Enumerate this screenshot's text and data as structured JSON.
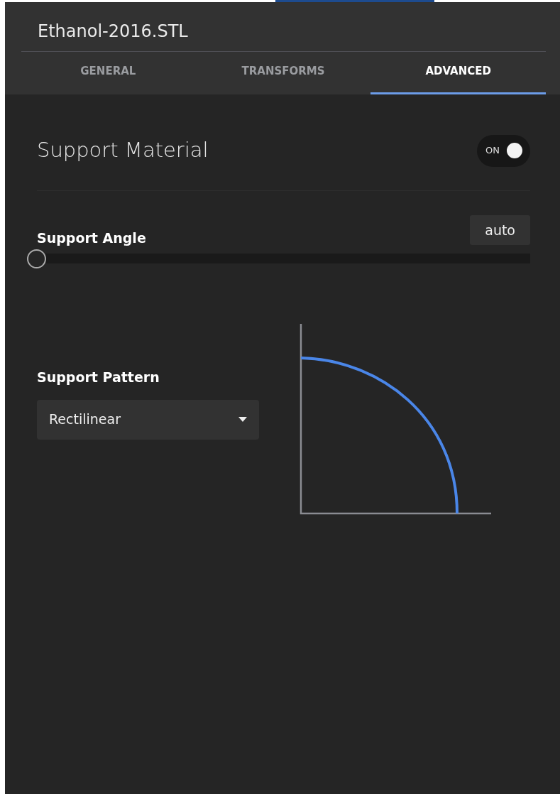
{
  "file_title": "Ethanol-2016.STL",
  "tabs": [
    {
      "label": "GENERAL",
      "selected": false
    },
    {
      "label": "TRANSFORMS",
      "selected": false
    },
    {
      "label": "ADVANCED",
      "selected": true
    }
  ],
  "support_material": {
    "label": "Support Material",
    "toggle_label": "ON",
    "on": true
  },
  "support_angle": {
    "label": "Support Angle",
    "value": "auto",
    "level": 0
  },
  "support_pattern": {
    "label": "Support Pattern",
    "value": "Rectilinear"
  }
}
